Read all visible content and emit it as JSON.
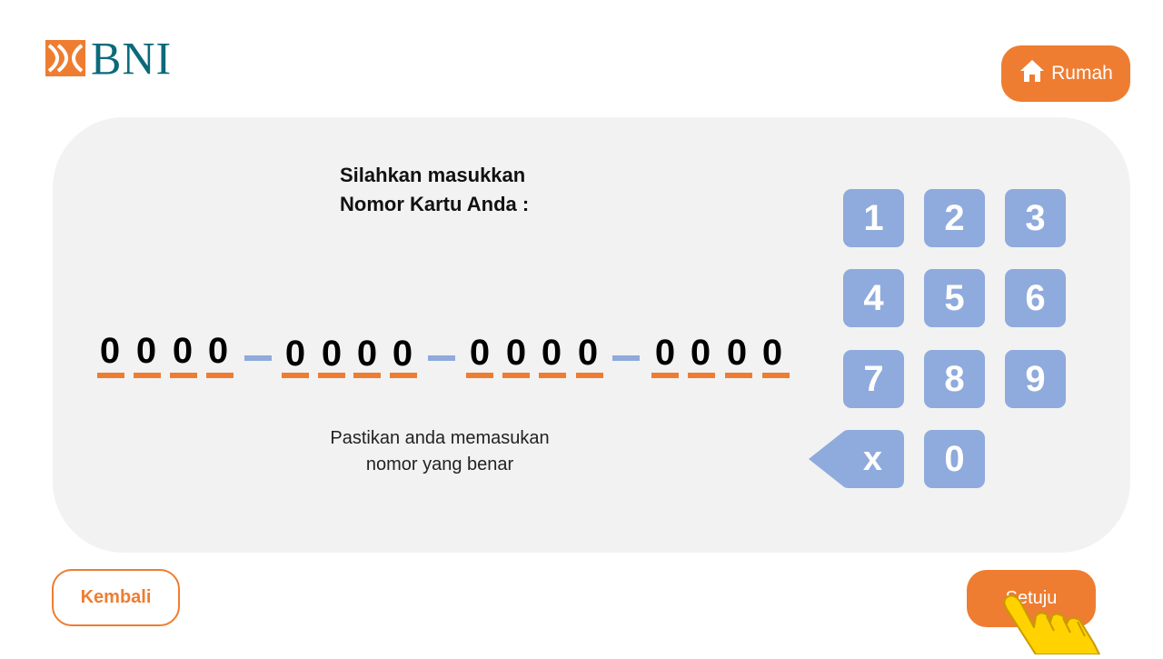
{
  "brand": {
    "name": "BNI",
    "logo_icon": "bni-wave-logo-icon",
    "accent": "#ee7d31",
    "brand_color": "#0b6a7a"
  },
  "header": {
    "home_button": {
      "label": "Rumah",
      "icon": "home-icon"
    }
  },
  "prompt": {
    "line1": "Silahkan masukkan",
    "line2": "Nomor Kartu Anda :"
  },
  "card_number": {
    "groups": [
      [
        "0",
        "0",
        "0",
        "0"
      ],
      [
        "0",
        "0",
        "0",
        "0"
      ],
      [
        "0",
        "0",
        "0",
        "0"
      ],
      [
        "0",
        "0",
        "0",
        "0"
      ]
    ]
  },
  "hint": {
    "line1": "Pastikan anda memasukan",
    "line2": "nomor yang benar"
  },
  "keypad": {
    "keys": [
      "1",
      "2",
      "3",
      "4",
      "5",
      "6",
      "7",
      "8",
      "9",
      "0"
    ],
    "delete_label": "x",
    "key_color": "#8faadc"
  },
  "footer": {
    "back_label": "Kembali",
    "agree_label": "Setuju"
  }
}
